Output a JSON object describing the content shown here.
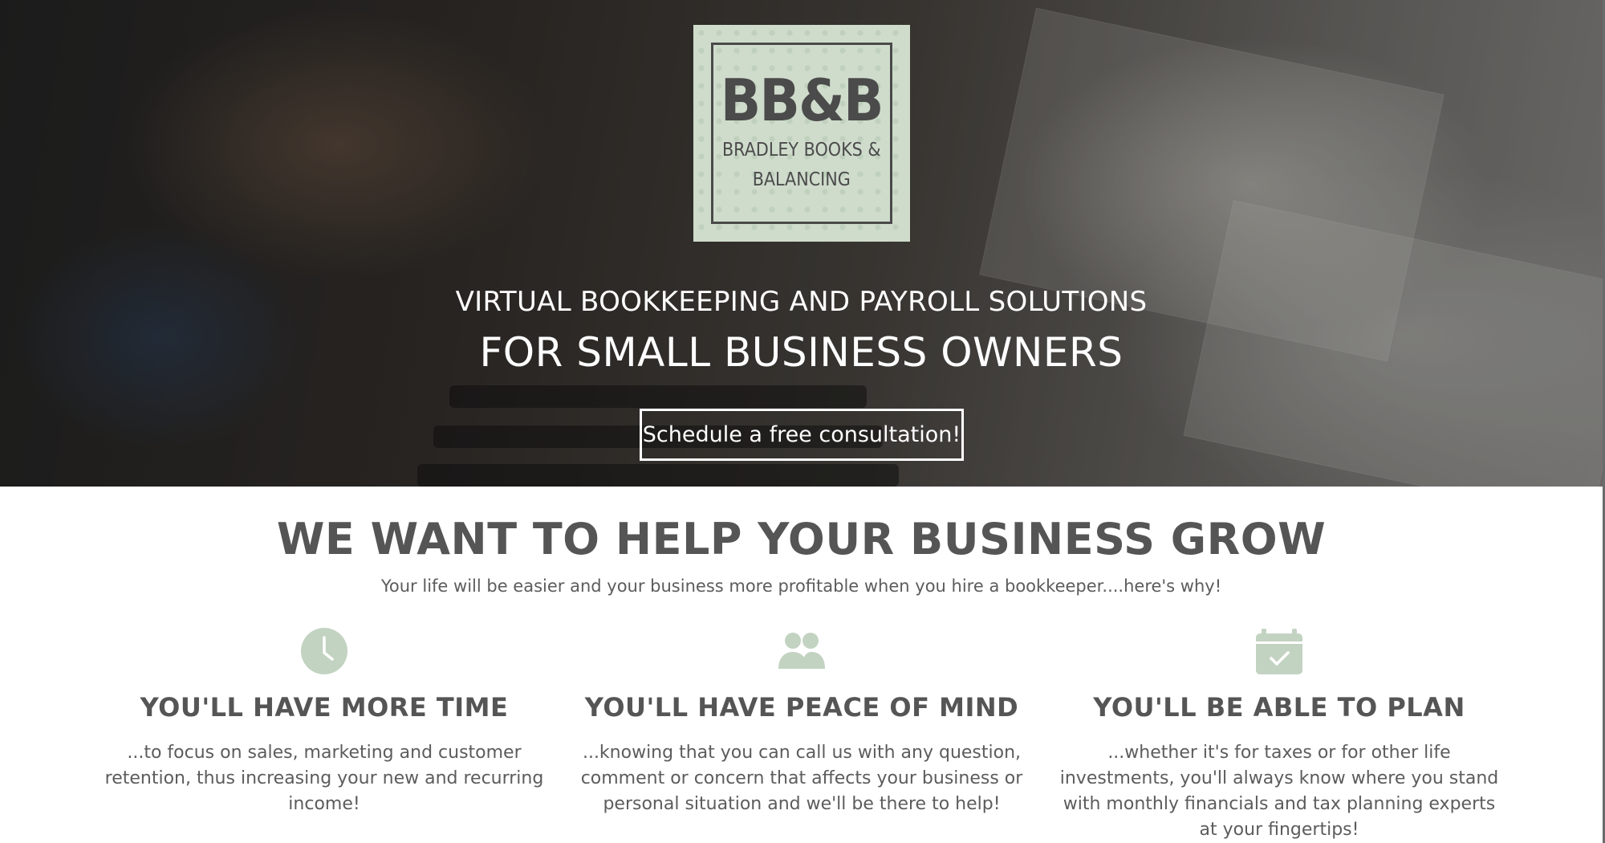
{
  "hero": {
    "logo": {
      "mark": "BB&B",
      "name_line1": "BRADLEY BOOKS &",
      "name_line2": "BALANCING"
    },
    "tagline_line1": "VIRTUAL BOOKKEEPING AND PAYROLL SOLUTIONS",
    "tagline_line2": "FOR SMALL BUSINESS OWNERS",
    "cta_label": "Schedule a free consultation!"
  },
  "section": {
    "title": "WE WANT TO HELP YOUR BUSINESS GROW",
    "subtitle": "Your life will be easier and your business more profitable when you hire a bookkeeper....here's why!"
  },
  "features": [
    {
      "icon": "clock-icon",
      "title": "YOU'LL HAVE MORE TIME",
      "text": "...to focus on sales, marketing and customer retention, thus increasing your new and recurring income!"
    },
    {
      "icon": "users-icon",
      "title": "YOU'LL HAVE PEACE OF MIND",
      "text": "...knowing that you can call us with any question, comment or concern that affects your business or personal situation and we'll be there to help!"
    },
    {
      "icon": "calendar-check-icon",
      "title": "YOU'LL BE ABLE TO PLAN",
      "text": "...whether it's for taxes or for other life investments, you'll always know where you stand with monthly financials and tax planning experts at your fingertips!"
    }
  ],
  "colors": {
    "accent_sage": "#c3d3c2",
    "logo_background": "#cfdccc",
    "text_gray": "#555555",
    "hero_text": "#ffffff"
  }
}
